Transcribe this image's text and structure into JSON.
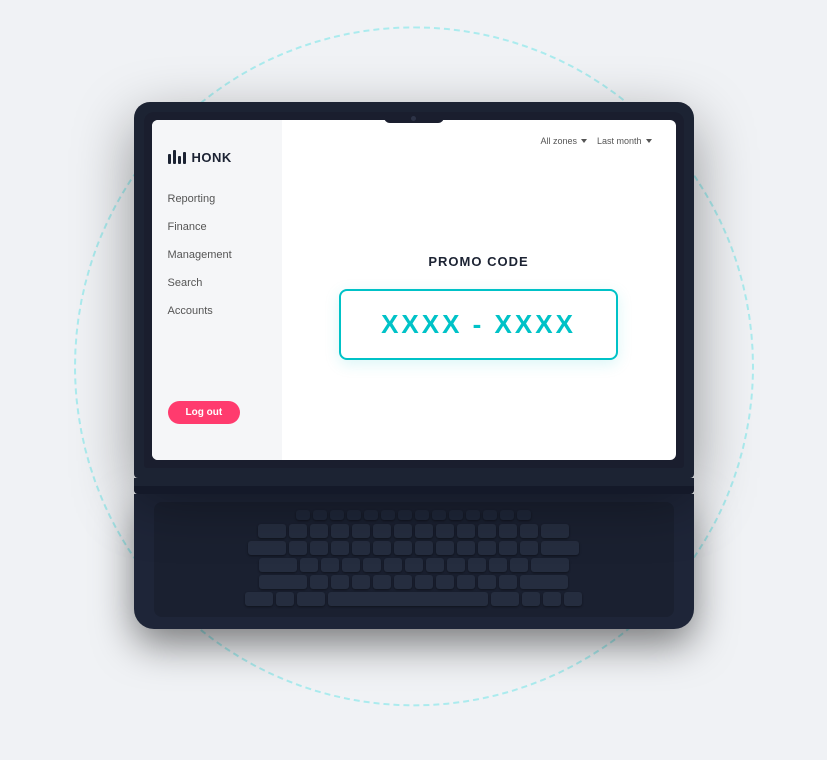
{
  "app": {
    "logo_text": "HONK",
    "dashed_circle": true
  },
  "sidebar": {
    "nav_items": [
      {
        "label": "Reporting",
        "id": "reporting"
      },
      {
        "label": "Finance",
        "id": "finance"
      },
      {
        "label": "Management",
        "id": "management"
      },
      {
        "label": "Search",
        "id": "search"
      },
      {
        "label": "Accounts",
        "id": "accounts"
      }
    ],
    "logout_label": "Log out"
  },
  "filters": {
    "zone_label": "All zones",
    "time_label": "Last month"
  },
  "promo": {
    "title": "PROMO CODE",
    "code": "XXXX - XXXX"
  },
  "colors": {
    "accent_teal": "#00c2c7",
    "accent_pink": "#ff3b6e",
    "dark_bg": "#1c2333",
    "sidebar_bg": "#f5f6f8"
  }
}
